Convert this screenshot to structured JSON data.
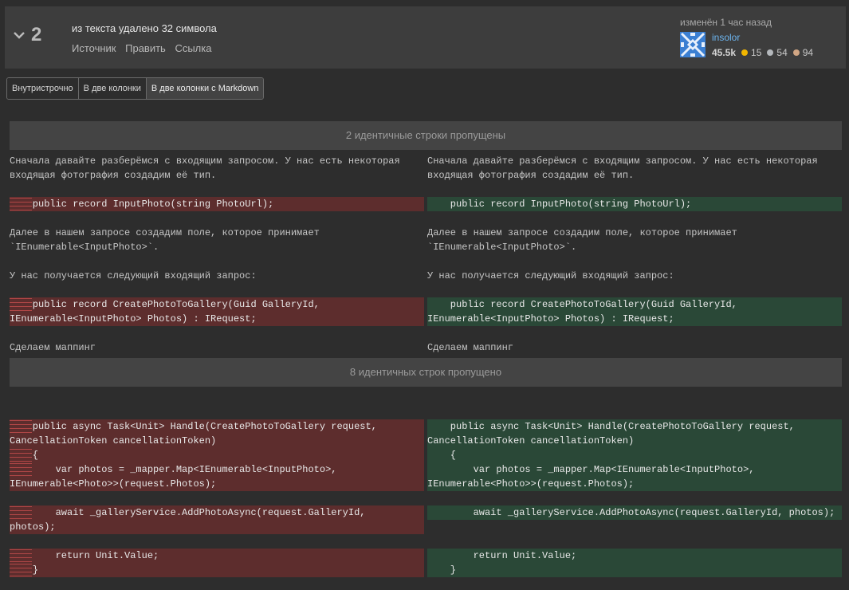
{
  "revision": {
    "number": "2",
    "summary": "из текста удалено 32 символа",
    "links": [
      "Источник",
      "Править",
      "Ссылка"
    ],
    "edited": "изменён 1 час назад",
    "user": {
      "name": "insolor",
      "reputation": "45.5k",
      "gold": "15",
      "silver": "54",
      "bronze": "94"
    }
  },
  "colors": {
    "gold": "#f1b600",
    "silver": "#b4b8bc",
    "bronze": "#d1a684",
    "deleted": "#5d2d2d",
    "inserted": "#2a4837"
  },
  "view_tabs": [
    "Внутристрочно",
    "В две колонки",
    "В две колонки с Markdown"
  ],
  "skipped": {
    "first": "2 идентичные строки пропущены",
    "second": "8 идентичных строк пропущено"
  },
  "left": {
    "l1": "Сначала давайте разберёмся с входящим запросом. У нас есть некоторая",
    "l2": "входящая фотография создадим её тип.",
    "l3": "    public record InputPhoto(string PhotoUrl);",
    "l4": "Далее в нашем запросе создадим поле, которое принимает",
    "l5": "`IEnumerable<InputPhoto>`.",
    "l6": "У нас получается следующий входящий запрос:",
    "l7": "    public record CreatePhotoToGallery(Guid GalleryId,",
    "l8": "IEnumerable<InputPhoto> Photos) : IRequest;",
    "l9": "Сделаем маппинг",
    "l10": "    public async Task<Unit> Handle(CreatePhotoToGallery request,",
    "l11": "CancellationToken cancellationToken)",
    "l12": "    {",
    "l13": "        var photos = _mapper.Map<IEnumerable<InputPhoto>,",
    "l14": "IEnumerable<Photo>>(request.Photos);",
    "l15": "        await _galleryService.AddPhotoAsync(request.GalleryId,",
    "l16": "photos);",
    "l17": "        return Unit.Value;",
    "l18": "    }"
  },
  "right": {
    "l1": "Сначала давайте разберёмся с входящим запросом. У нас есть некоторая",
    "l2": "входящая фотография создадим её тип.",
    "l3": "    public record InputPhoto(string PhotoUrl);",
    "l4": "Далее в нашем запросе создадим поле, которое принимает",
    "l5": "`IEnumerable<InputPhoto>`.",
    "l6": "У нас получается следующий входящий запрос:",
    "l7": "    public record CreatePhotoToGallery(Guid GalleryId,",
    "l8": "IEnumerable<InputPhoto> Photos) : IRequest;",
    "l9": "Сделаем маппинг",
    "l10": "    public async Task<Unit> Handle(CreatePhotoToGallery request,",
    "l11": "CancellationToken cancellationToken)",
    "l12": "    {",
    "l13": "        var photos = _mapper.Map<IEnumerable<InputPhoto>,",
    "l14": "IEnumerable<Photo>>(request.Photos);",
    "l15": "        await _galleryService.AddPhotoAsync(request.GalleryId, photos);",
    "l17": "        return Unit.Value;",
    "l18": "    }"
  }
}
